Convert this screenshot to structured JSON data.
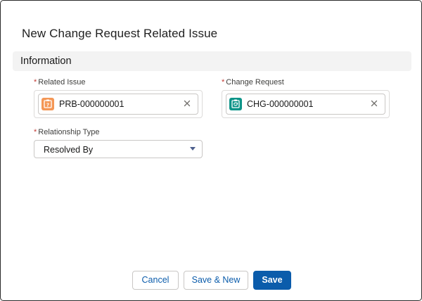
{
  "modal": {
    "title": "New Change Request Related Issue"
  },
  "section": {
    "title": "Information"
  },
  "fields": {
    "related_issue": {
      "label": "Related Issue",
      "required_marker": "*",
      "value": "PRB-000000001",
      "icon": "problem-object-icon",
      "icon_color": "#f49756"
    },
    "change_request": {
      "label": "Change Request",
      "required_marker": "*",
      "value": "CHG-000000001",
      "icon": "change-request-object-icon",
      "icon_color": "#0d9488"
    },
    "relationship_type": {
      "label": "Relationship Type",
      "required_marker": "*",
      "selected": "Resolved By"
    }
  },
  "footer": {
    "cancel_label": "Cancel",
    "save_new_label": "Save & New",
    "save_label": "Save"
  },
  "colors": {
    "brand": "#0b5cab",
    "required": "#c23934",
    "section_bg": "#f3f3f3"
  }
}
